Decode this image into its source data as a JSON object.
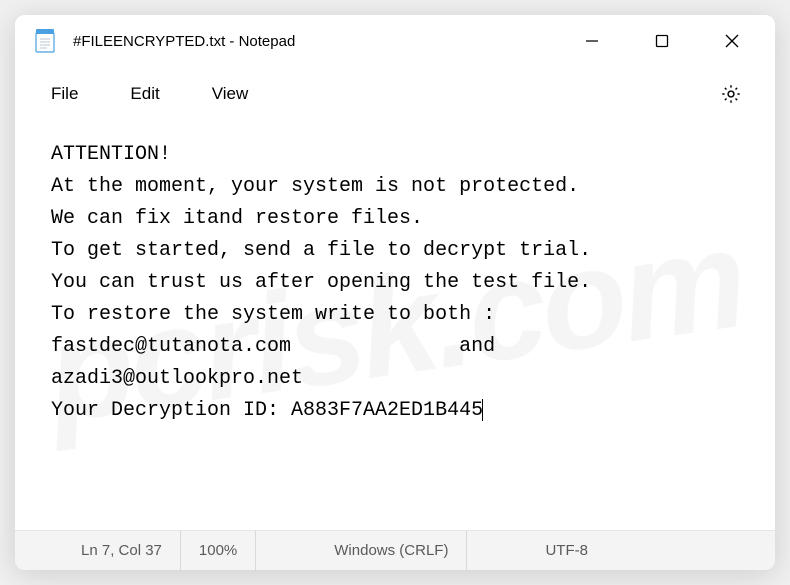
{
  "titlebar": {
    "title": "#FILEENCRYPTED.txt - Notepad"
  },
  "menu": {
    "file": "File",
    "edit": "Edit",
    "view": "View"
  },
  "content": {
    "text": "ATTENTION!\nAt the moment, your system is not protected.\nWe can fix itand restore files.\nTo get started, send a file to decrypt trial.\nYou can trust us after opening the test file.\nTo restore the system write to both :\nfastdec@tutanota.com              and azadi3@outlookpro.net\nYour Decryption ID: A883F7AA2ED1B445"
  },
  "statusbar": {
    "position": "Ln 7, Col 37",
    "zoom": "100%",
    "line_ending": "Windows (CRLF)",
    "encoding": "UTF-8"
  },
  "watermark": "pcrisk.com"
}
